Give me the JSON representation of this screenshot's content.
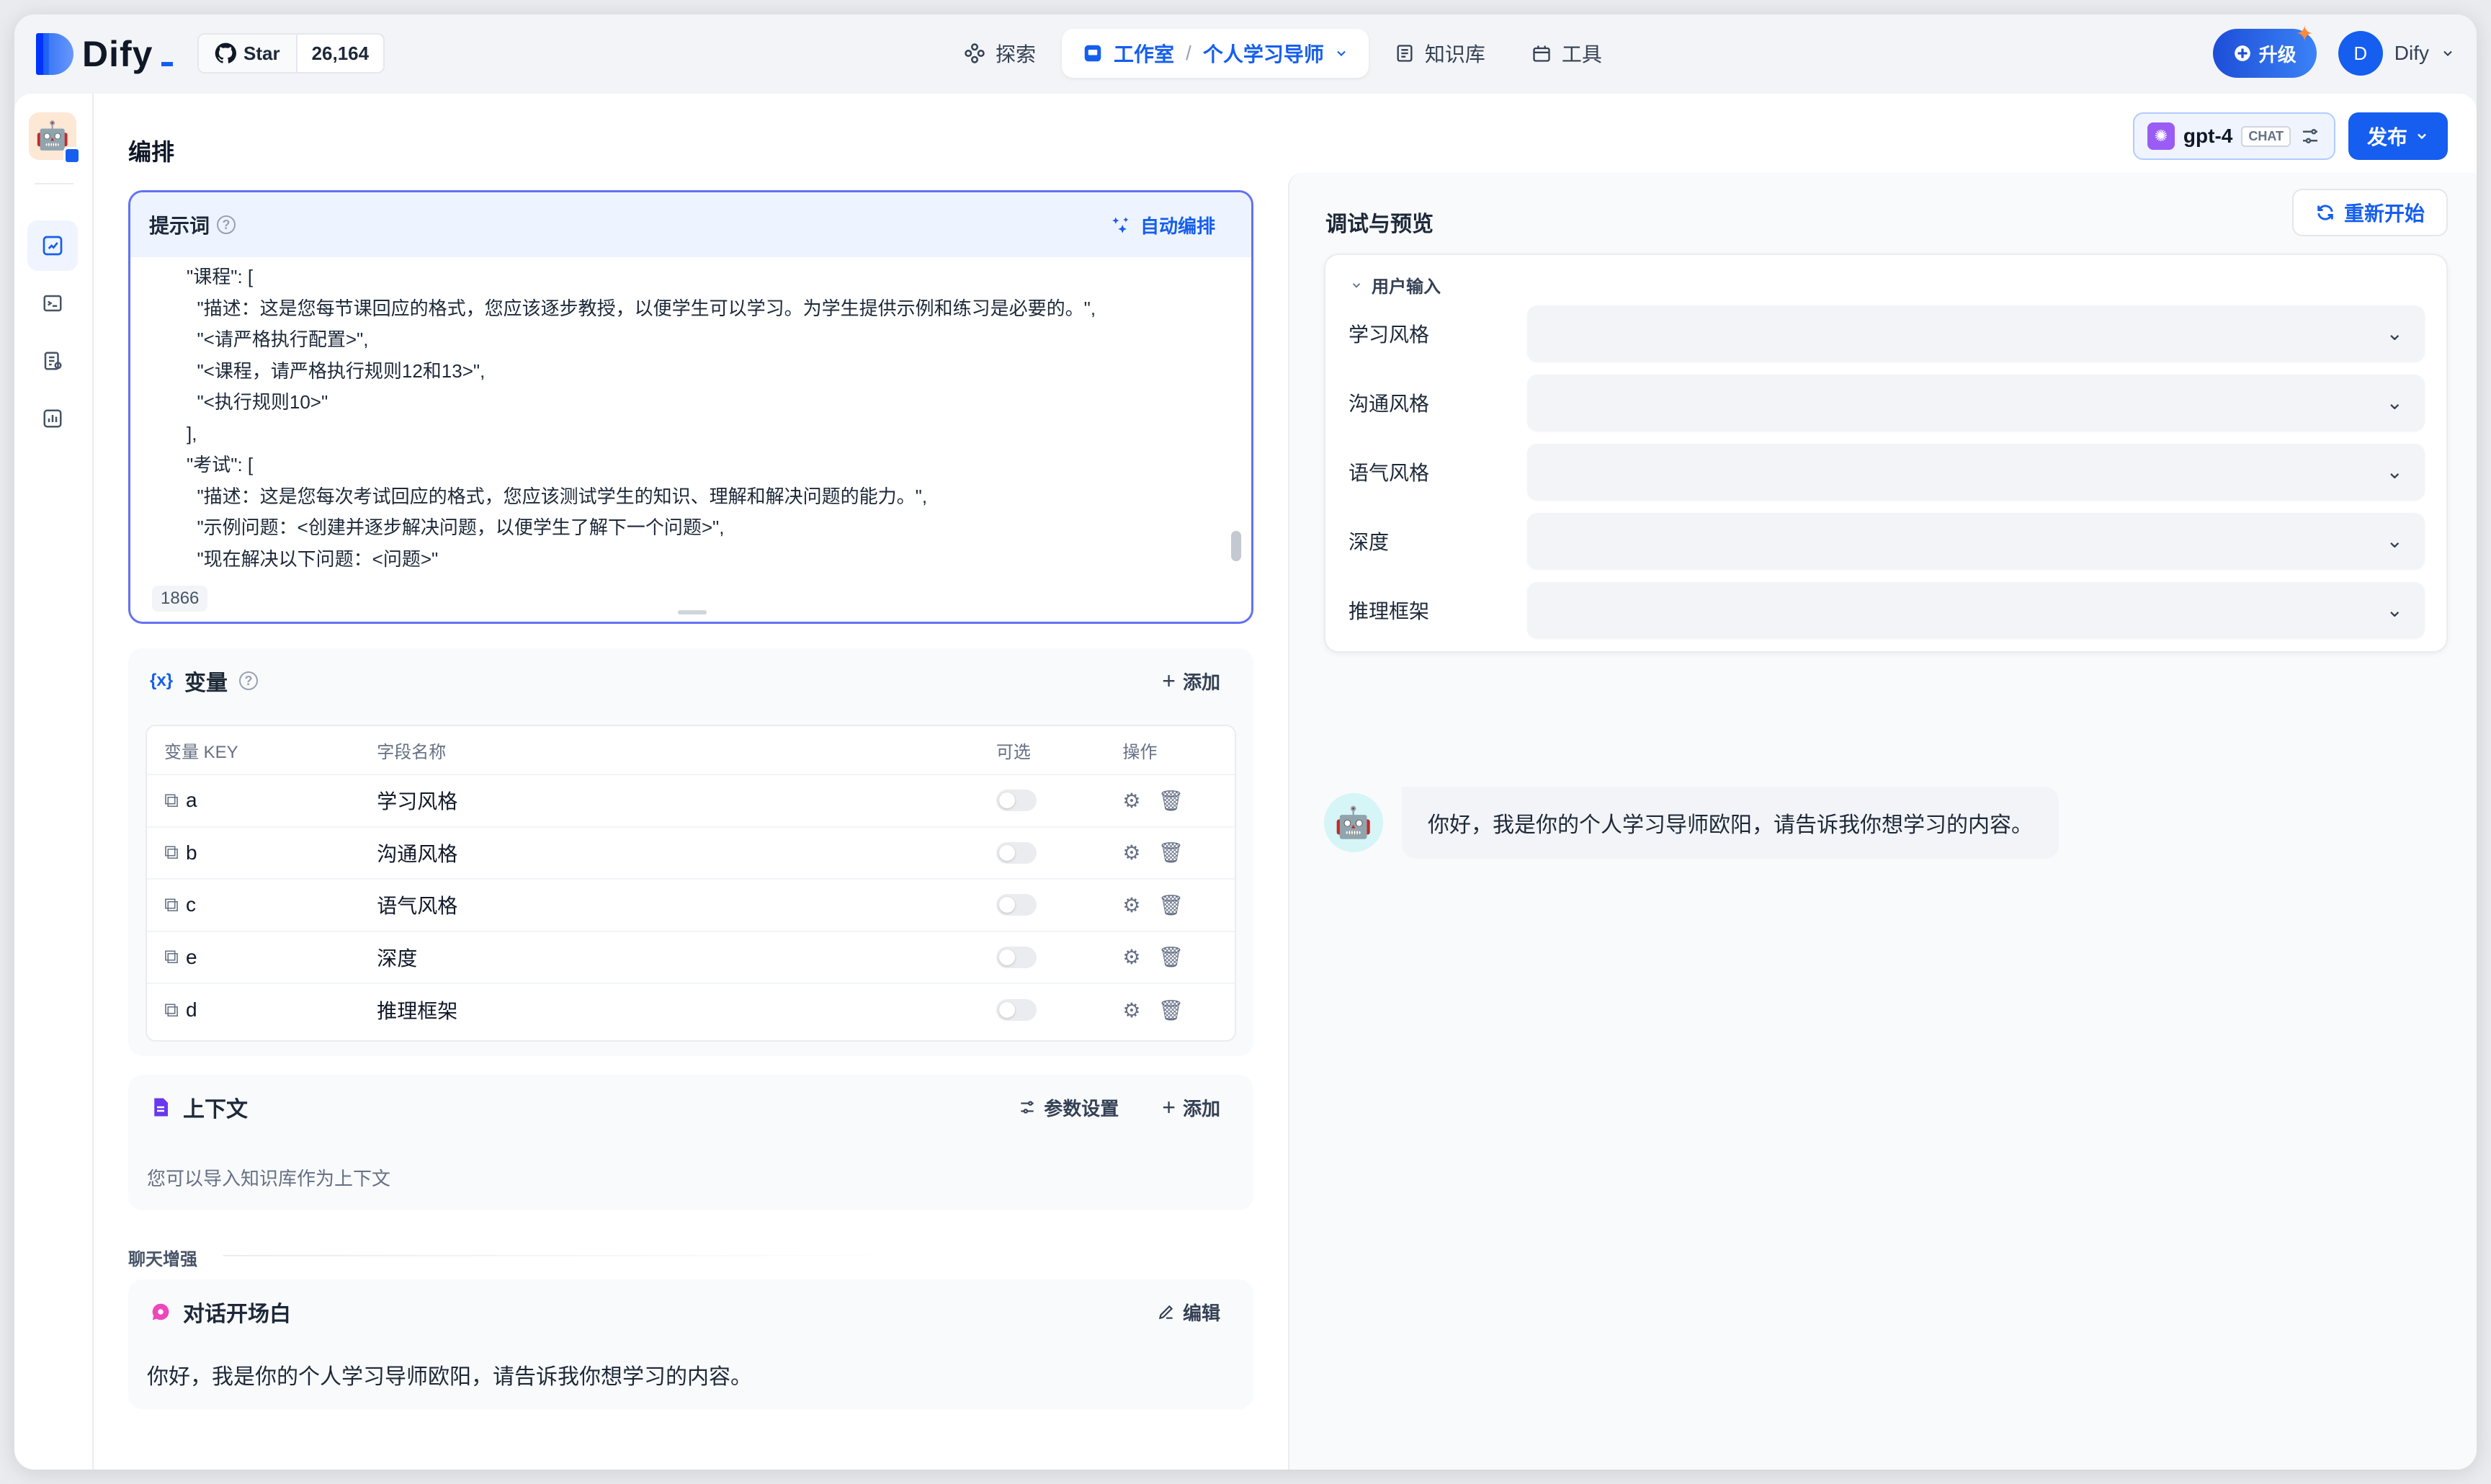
{
  "topnav": {
    "brand": "Dify",
    "github": {
      "star_label": "Star",
      "count": "26,164"
    },
    "nav": {
      "explore": "探索",
      "studio": "工作室",
      "app_name": "个人学习导师",
      "knowledge": "知识库",
      "tools": "工具"
    },
    "upgrade": "升级",
    "user": {
      "initial": "D",
      "name": "Dify"
    }
  },
  "header": {
    "title": "编排",
    "model": {
      "name": "gpt-4",
      "mode": "CHAT"
    },
    "publish": "发布"
  },
  "prompt": {
    "title": "提示词",
    "auto_label": "自动编排",
    "lines": [
      "\"课程\": [",
      "  \"描述：这是您每节课回应的格式，您应该逐步教授，以便学生可以学习。为学生提供示例和练习是必要的。\",",
      "  \"<请严格执行配置>\",",
      "  \"<课程，请严格执行规则12和13>\",",
      "  \"<执行规则10>\"",
      "],",
      "\"考试\": [",
      "  \"描述：这是您每次考试回应的格式，您应该测试学生的知识、理解和解决问题的能力。\",",
      "  \"示例问题：<创建并逐步解决问题，以便学生了解下一个问题>\",",
      "  \"现在解决以下问题：<问题>\""
    ],
    "char_count": "1866"
  },
  "variables": {
    "title": "变量",
    "add_label": "添加",
    "columns": {
      "key": "变量 KEY",
      "name": "字段名称",
      "optional": "可选",
      "actions": "操作"
    },
    "rows": [
      {
        "key": "a",
        "name": "学习风格"
      },
      {
        "key": "b",
        "name": "沟通风格"
      },
      {
        "key": "c",
        "name": "语气风格"
      },
      {
        "key": "e",
        "name": "深度"
      },
      {
        "key": "d",
        "name": "推理框架"
      }
    ]
  },
  "context": {
    "title": "上下文",
    "params_label": "参数设置",
    "add_label": "添加",
    "description": "您可以导入知识库作为上下文"
  },
  "chat_enhance": {
    "label": "聊天增强",
    "opener": {
      "title": "对话开场白",
      "edit_label": "编辑",
      "text": "你好，我是你的个人学习导师欧阳，请告诉我你想学习的内容。"
    }
  },
  "debug": {
    "title": "调试与预览",
    "restart": "重新开始",
    "user_input_label": "用户输入",
    "fields": [
      "学习风格",
      "沟通风格",
      "语气风格",
      "深度",
      "推理框架"
    ],
    "bot_message": "你好，我是你的个人学习导师欧阳，请告诉我你想学习的内容。"
  }
}
